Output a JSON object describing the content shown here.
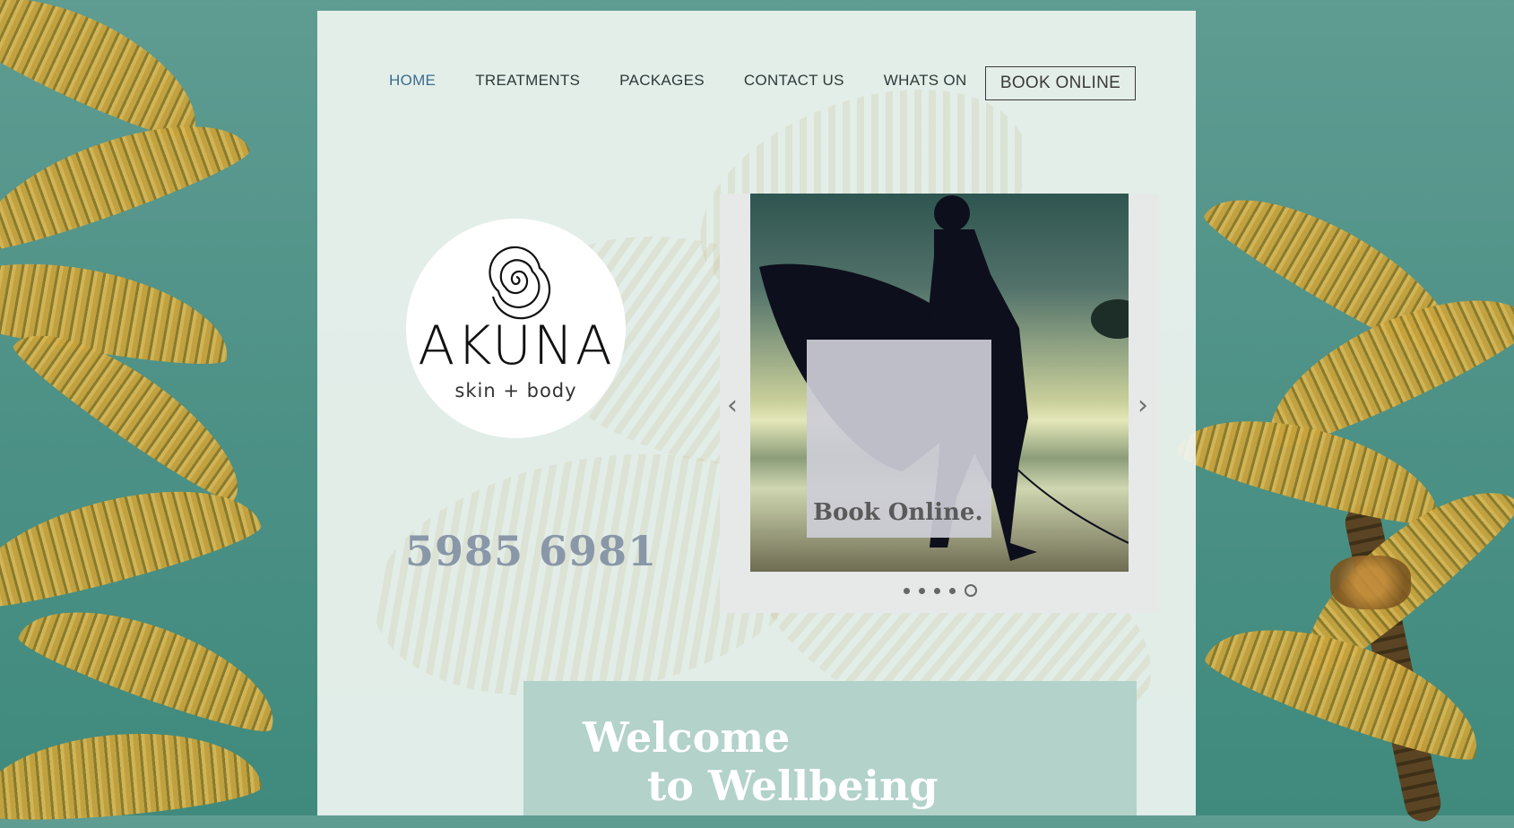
{
  "nav": {
    "items": [
      {
        "label": "HOME",
        "active": true
      },
      {
        "label": "TREATMENTS",
        "active": false
      },
      {
        "label": "PACKAGES",
        "active": false
      },
      {
        "label": "CONTACT US",
        "active": false
      },
      {
        "label": "WHATS ON",
        "active": false
      }
    ],
    "book_label": "BOOK ONLINE"
  },
  "logo": {
    "name": "AKUNA",
    "tagline": "skin + body"
  },
  "phone": "5985 6981",
  "slideshow": {
    "overlay_text": "Book Online.",
    "slide_count": 5,
    "current_slide": 5,
    "prev_icon": "chevron-left-icon",
    "next_icon": "chevron-right-icon"
  },
  "welcome": {
    "line1": "Welcome",
    "line2": "to Wellbeing"
  },
  "colors": {
    "nav_active": "#3b6d8f",
    "welcome_bg": "#b2d2ca",
    "phone": "#8997a8"
  }
}
